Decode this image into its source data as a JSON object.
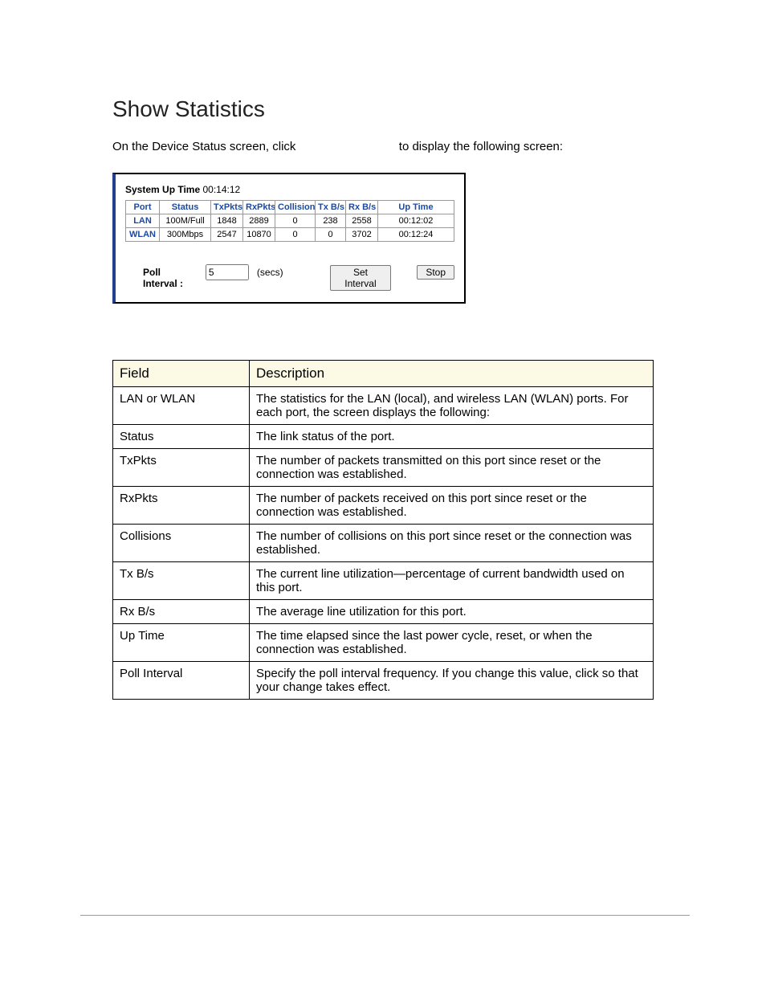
{
  "title": "Show Statistics",
  "intro_before": "On the Device Status screen, click ",
  "intro_after": " to display the following screen:",
  "shot": {
    "uptime_label": "System Up Time",
    "uptime_value": "00:14:12",
    "headers": [
      "Port",
      "Status",
      "TxPkts",
      "RxPkts",
      "Collisions",
      "Tx B/s",
      "Rx B/s",
      "Up Time"
    ],
    "rows": [
      {
        "port": "LAN",
        "status": "100M/Full",
        "tx": "1848",
        "rx": "2889",
        "col": "0",
        "txbs": "238",
        "rxbs": "2558",
        "up": "00:12:02"
      },
      {
        "port": "WLAN",
        "status": "300Mbps",
        "tx": "2547",
        "rx": "10870",
        "col": "0",
        "txbs": "0",
        "rxbs": "3702",
        "up": "00:12:24"
      }
    ],
    "poll_label": "Poll Interval :",
    "poll_value": "5",
    "poll_unit": "(secs)",
    "btn_set": "Set Interval",
    "btn_stop": "Stop"
  },
  "desc": {
    "head_field": "Field",
    "head_desc": "Description",
    "rows": [
      {
        "f": "LAN or WLAN",
        "d": "The statistics for the LAN (local), and wireless LAN (WLAN) ports. For each port, the screen displays the following:"
      },
      {
        "f": "Status",
        "d": "The link status of the port."
      },
      {
        "f": "TxPkts",
        "d": "The number of packets transmitted on this port since reset or the connection was established."
      },
      {
        "f": "RxPkts",
        "d": "The number of packets received on this port since reset or the connection was established."
      },
      {
        "f": "Collisions",
        "d": "The number of collisions on this port since reset or the connection was established."
      },
      {
        "f": "Tx B/s",
        "d": "The current line utilization—percentage of current bandwidth used on this port."
      },
      {
        "f": "Rx B/s",
        "d": "The average line utilization for this port."
      },
      {
        "f": "Up Time",
        "d": "The time elapsed since the last power cycle, reset, or when the connection was established."
      },
      {
        "f": "Poll Interval",
        "d": "Specify the poll interval frequency. If you change this value, click               so that your change takes effect."
      }
    ]
  }
}
